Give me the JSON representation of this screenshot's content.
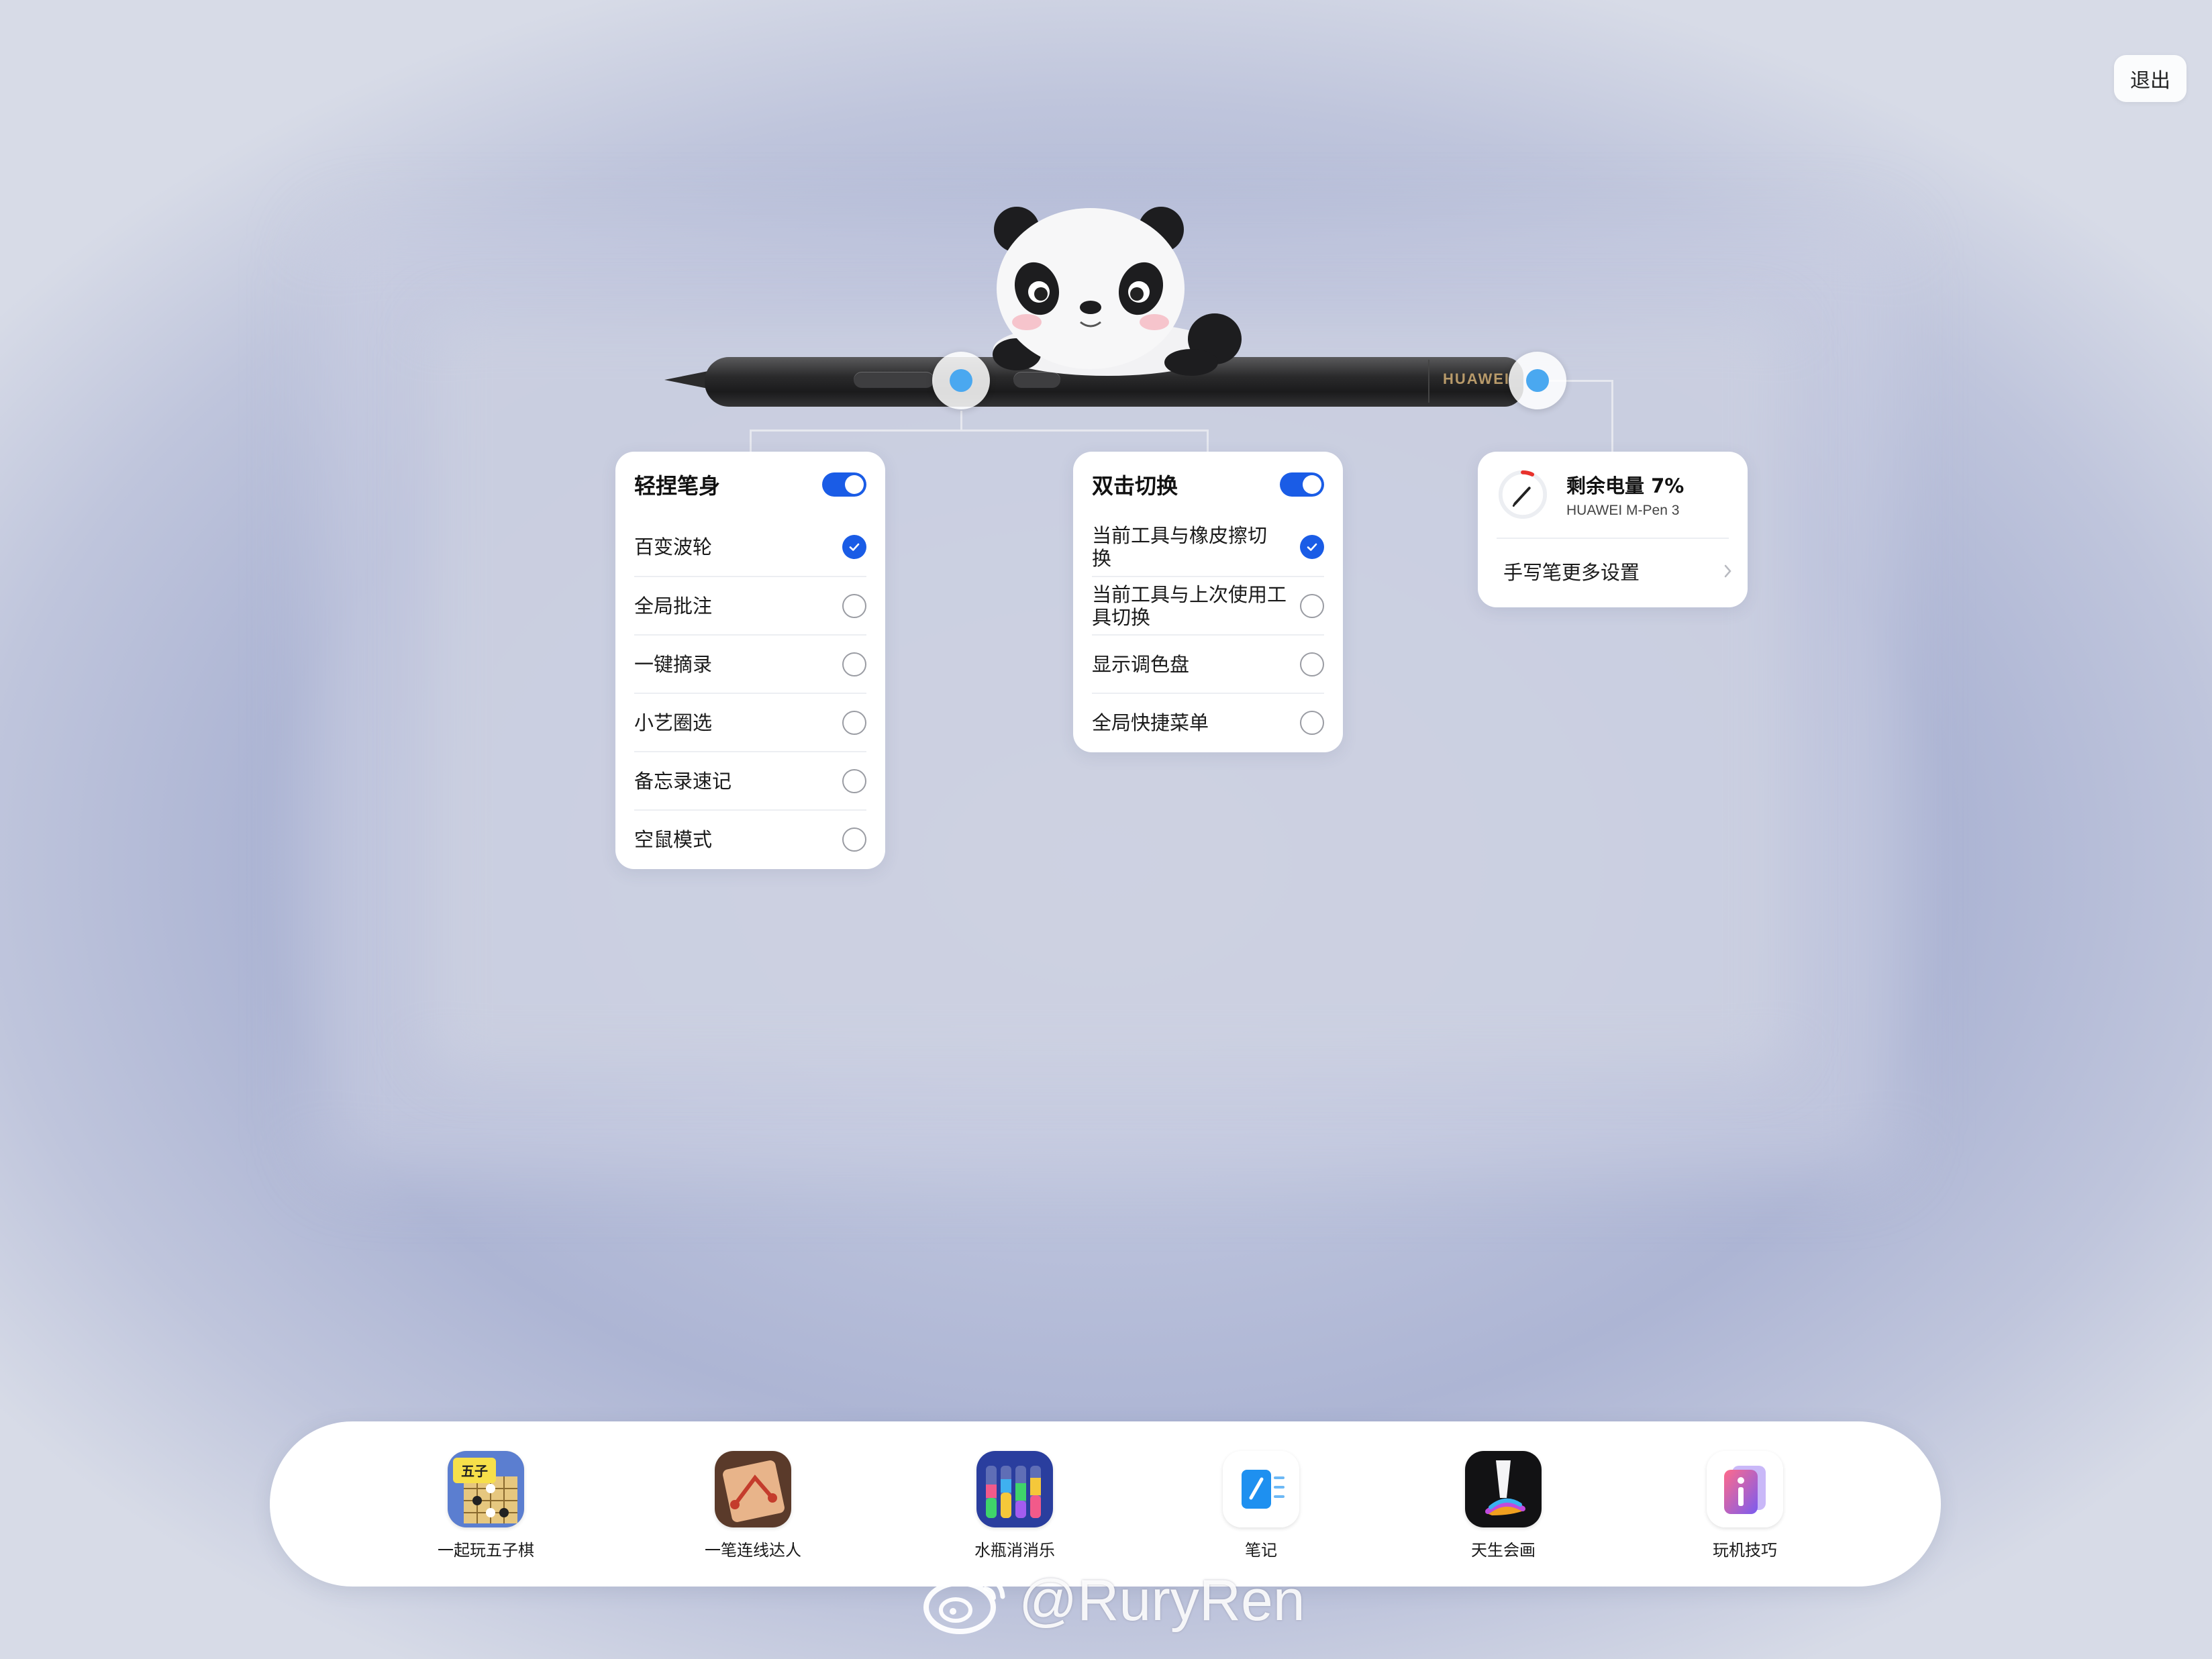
{
  "header": {
    "exit_label": "退出"
  },
  "pen": {
    "brand": "HUAWEI"
  },
  "squeeze_card": {
    "title": "轻捏笔身",
    "enabled": true,
    "options": [
      {
        "label": "百变波轮",
        "selected": true
      },
      {
        "label": "全局批注",
        "selected": false
      },
      {
        "label": "一键摘录",
        "selected": false
      },
      {
        "label": "小艺圈选",
        "selected": false
      },
      {
        "label": "备忘录速记",
        "selected": false
      },
      {
        "label": "空鼠模式",
        "selected": false
      }
    ]
  },
  "double_tap_card": {
    "title": "双击切换",
    "enabled": true,
    "options": [
      {
        "label_line1": "当前工具与橡皮擦切",
        "label_line2": "换",
        "selected": true
      },
      {
        "label_line1": "当前工具与上次使用工",
        "label_line2": "具切换",
        "selected": false
      },
      {
        "label_line1": "显示调色盘",
        "label_line2": "",
        "selected": false
      },
      {
        "label_line1": "全局快捷菜单",
        "label_line2": "",
        "selected": false
      }
    ]
  },
  "battery_card": {
    "title": "剩余电量 7%",
    "battery_percent": 7,
    "device": "HUAWEI M-Pen 3",
    "more_settings": "手写笔更多设置",
    "ring_color": "#e8322c"
  },
  "dock": {
    "apps": [
      {
        "label": "一起玩五子棋",
        "icon": "gomoku-icon"
      },
      {
        "label": "一笔连线达人",
        "icon": "one-line-icon"
      },
      {
        "label": "水瓶消消乐",
        "icon": "bottle-sort-icon"
      },
      {
        "label": "笔记",
        "icon": "notes-icon"
      },
      {
        "label": "天生会画",
        "icon": "painting-icon"
      },
      {
        "label": "玩机技巧",
        "icon": "tips-icon"
      }
    ]
  },
  "watermark": {
    "text": "@RuryRen"
  },
  "colors": {
    "accent": "#1a5ce6",
    "dot": "#4aa8f0"
  }
}
